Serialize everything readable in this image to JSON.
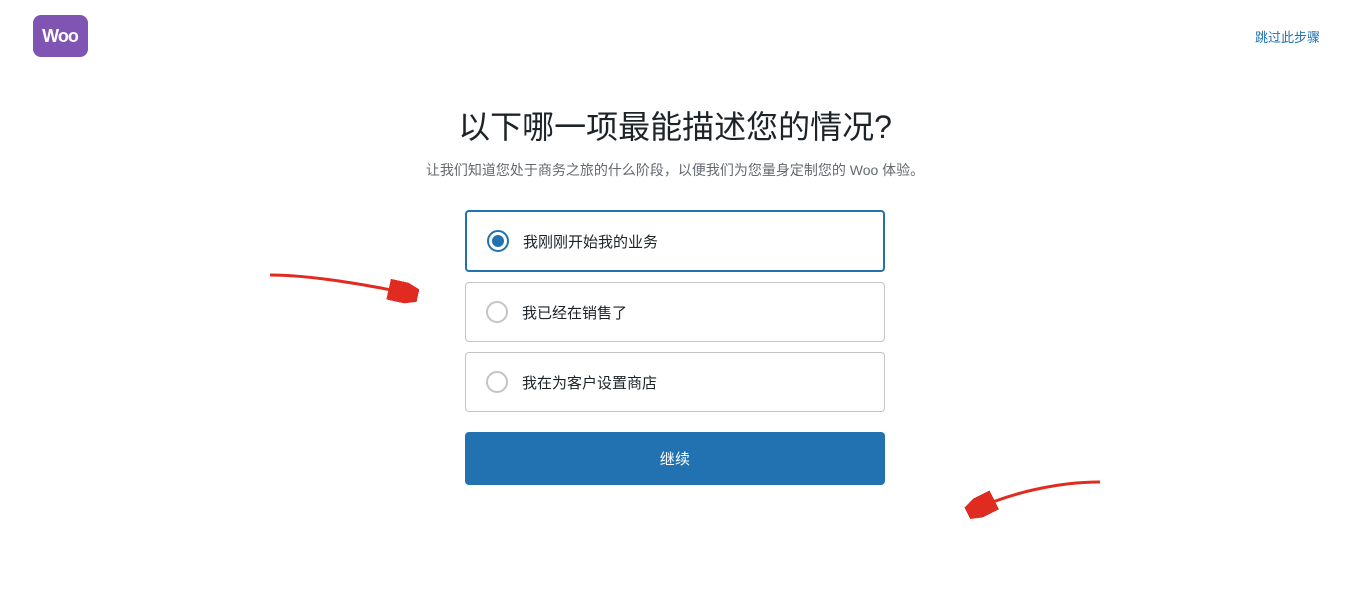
{
  "header": {
    "logo_text": "Woo",
    "skip_label": "跳过此步骤"
  },
  "page": {
    "title": "以下哪一项最能描述您的情况?",
    "subtitle": "让我们知道您处于商务之旅的什么阶段，以便我们为您量身定制您的 Woo 体验。"
  },
  "options": [
    {
      "id": "option1",
      "label": "我刚刚开始我的业务",
      "selected": true
    },
    {
      "id": "option2",
      "label": "我已经在销售了",
      "selected": false
    },
    {
      "id": "option3",
      "label": "我在为客户设置商店",
      "selected": false
    }
  ],
  "continue_button": {
    "label": "继续"
  }
}
